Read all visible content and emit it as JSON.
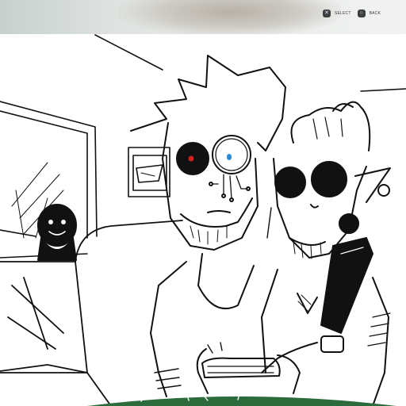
{
  "overlay": {
    "hints": [
      {
        "glyph": "✕",
        "label": "SELECT",
        "icon": "cross-button-icon"
      },
      {
        "glyph": "○",
        "label": "BACK",
        "icon": "circle-button-icon"
      }
    ]
  },
  "colors": {
    "ink": "#111111",
    "red_pupil": "#d42020",
    "blue_pupil": "#2a8ad6",
    "green_accent": "#2c6b3c",
    "top_bar": "#e6e9e7"
  }
}
